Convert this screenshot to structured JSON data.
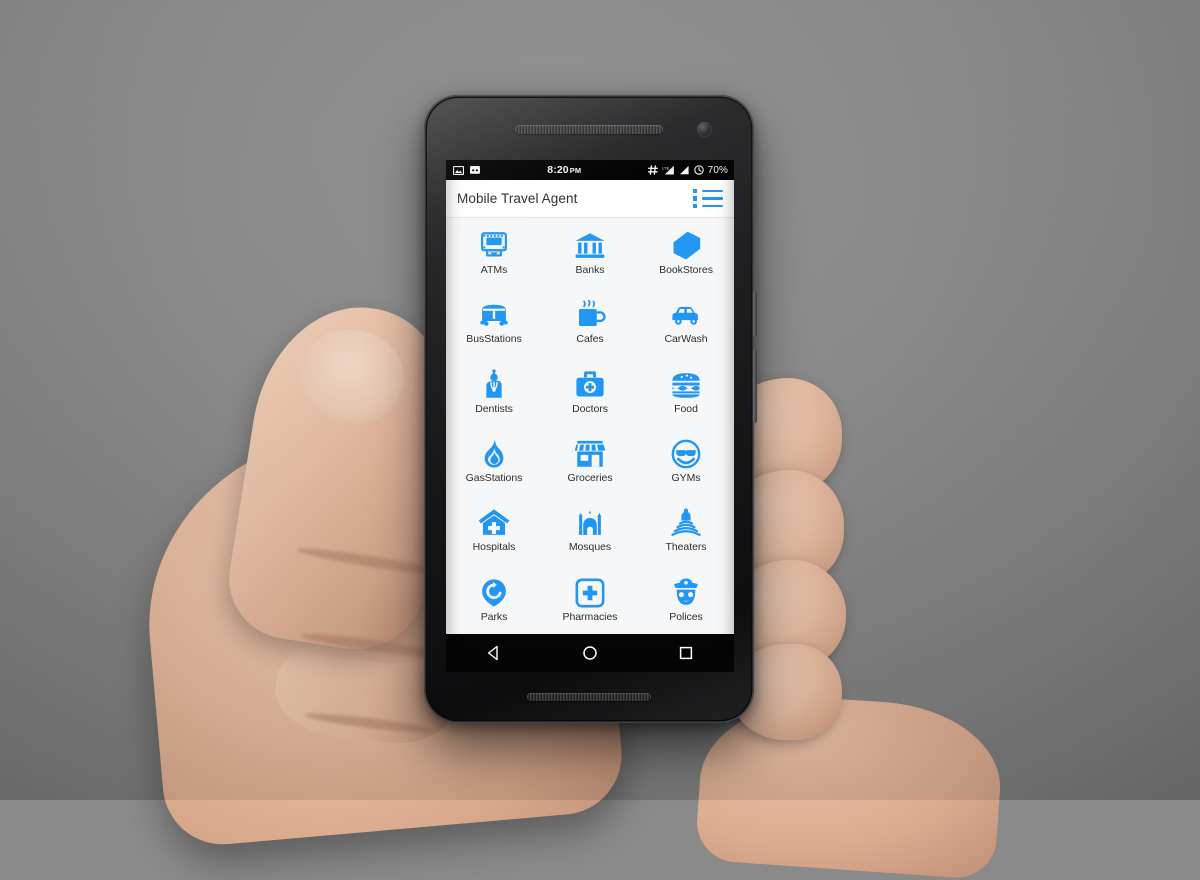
{
  "device": {
    "name": "android-smartphone",
    "frame_color": "#141416",
    "held_in_hand": true
  },
  "statusbar": {
    "icons_left": [
      "screenshot-icon",
      "android-robot-icon"
    ],
    "time": "8:20",
    "ampm": "PM",
    "icons_right": [
      "hash-icon",
      "lte-signal-icon",
      "signal-icon",
      "alarm-icon"
    ],
    "battery": "70%"
  },
  "appbar": {
    "title": "Mobile Travel Agent",
    "menu_icon": "list-view-icon",
    "accent_color": "#2196f3",
    "background": "#fefefe"
  },
  "grid": {
    "columns": 3,
    "rows": 6,
    "background": "#f6f7f8",
    "items": [
      {
        "label": "ATMs",
        "icon": "atm-icon"
      },
      {
        "label": "Banks",
        "icon": "bank-icon"
      },
      {
        "label": "BookStores",
        "icon": "books-icon"
      },
      {
        "label": "BusStations",
        "icon": "bus-icon"
      },
      {
        "label": "Cafes",
        "icon": "coffee-cup-icon"
      },
      {
        "label": "CarWash",
        "icon": "car-icon"
      },
      {
        "label": "Dentists",
        "icon": "dentist-person-icon"
      },
      {
        "label": "Doctors",
        "icon": "medical-bag-icon"
      },
      {
        "label": "Food",
        "icon": "burger-icon"
      },
      {
        "label": "GasStations",
        "icon": "flame-icon"
      },
      {
        "label": "Groceries",
        "icon": "storefront-icon"
      },
      {
        "label": "GYMs",
        "icon": "smiley-sunglasses-icon"
      },
      {
        "label": "Hospitals",
        "icon": "hospital-house-icon"
      },
      {
        "label": "Mosques",
        "icon": "mosque-icon"
      },
      {
        "label": "Theaters",
        "icon": "stage-performer-icon"
      },
      {
        "label": "Parks",
        "icon": "map-pin-refresh-icon"
      },
      {
        "label": "Pharmacies",
        "icon": "pharmacy-cross-icon"
      },
      {
        "label": "Polices",
        "icon": "police-officer-icon"
      }
    ]
  },
  "navbar": {
    "buttons": [
      {
        "name": "back-button",
        "icon": "triangle-back-icon"
      },
      {
        "name": "home-button",
        "icon": "circle-home-icon"
      },
      {
        "name": "recents-button",
        "icon": "square-recents-icon"
      }
    ],
    "background": "#050505"
  }
}
